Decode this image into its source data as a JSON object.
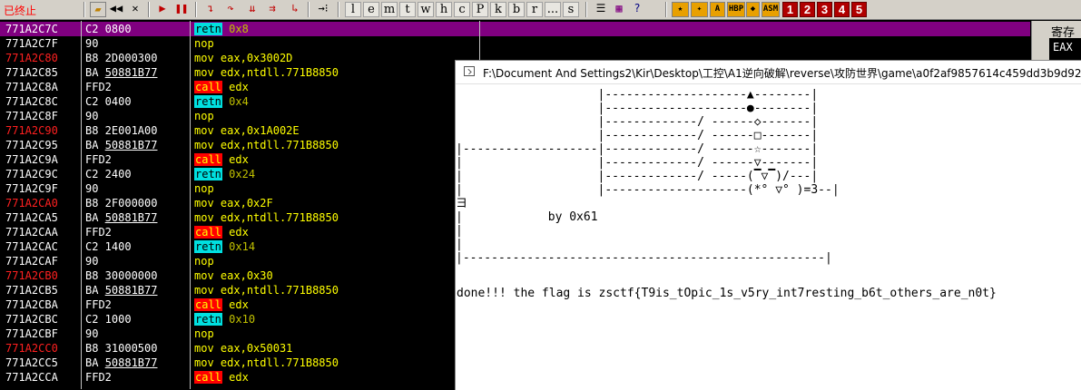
{
  "toolbar": {
    "status": "已终止",
    "letters": [
      "l",
      "e",
      "m",
      "t",
      "w",
      "h",
      "c",
      "P",
      "k",
      "b",
      "r",
      "...",
      "s"
    ],
    "numbers": [
      "1",
      "2",
      "3",
      "4",
      "5"
    ],
    "misc": [
      "HBP",
      "ASM"
    ]
  },
  "disasm": {
    "rows": [
      {
        "addr": "771A2C7C",
        "addr_red": false,
        "hex": "C2 0800",
        "mn": "retn",
        "kind": "ret",
        "ops": "0x8",
        "sel": true
      },
      {
        "addr": "771A2C7F",
        "addr_red": false,
        "hex": "90",
        "mn": "nop",
        "kind": "plain",
        "ops": ""
      },
      {
        "addr": "771A2C80",
        "addr_red": true,
        "hex": "B8 2D000300",
        "mn": "mov",
        "kind": "plain",
        "ops": "eax,0x3002D"
      },
      {
        "addr": "771A2C85",
        "addr_red": false,
        "hex": "BA 50881B77",
        "mn": "mov",
        "kind": "plain",
        "ops": "edx,ntdll.771B8850",
        "under": true
      },
      {
        "addr": "771A2C8A",
        "addr_red": false,
        "hex": "FFD2",
        "mn": "call",
        "kind": "call",
        "ops": "edx"
      },
      {
        "addr": "771A2C8C",
        "addr_red": false,
        "hex": "C2 0400",
        "mn": "retn",
        "kind": "ret",
        "ops": "0x4"
      },
      {
        "addr": "771A2C8F",
        "addr_red": false,
        "hex": "90",
        "mn": "nop",
        "kind": "plain",
        "ops": ""
      },
      {
        "addr": "771A2C90",
        "addr_red": true,
        "hex": "B8 2E001A00",
        "mn": "mov",
        "kind": "plain",
        "ops": "eax,0x1A002E"
      },
      {
        "addr": "771A2C95",
        "addr_red": false,
        "hex": "BA 50881B77",
        "mn": "mov",
        "kind": "plain",
        "ops": "edx,ntdll.771B8850",
        "under": true
      },
      {
        "addr": "771A2C9A",
        "addr_red": false,
        "hex": "FFD2",
        "mn": "call",
        "kind": "call",
        "ops": "edx"
      },
      {
        "addr": "771A2C9C",
        "addr_red": false,
        "hex": "C2 2400",
        "mn": "retn",
        "kind": "ret",
        "ops": "0x24"
      },
      {
        "addr": "771A2C9F",
        "addr_red": false,
        "hex": "90",
        "mn": "nop",
        "kind": "plain",
        "ops": ""
      },
      {
        "addr": "771A2CA0",
        "addr_red": true,
        "hex": "B8 2F000000",
        "mn": "mov",
        "kind": "plain",
        "ops": "eax,0x2F"
      },
      {
        "addr": "771A2CA5",
        "addr_red": false,
        "hex": "BA 50881B77",
        "mn": "mov",
        "kind": "plain",
        "ops": "edx,ntdll.771B8850",
        "under": true
      },
      {
        "addr": "771A2CAA",
        "addr_red": false,
        "hex": "FFD2",
        "mn": "call",
        "kind": "call",
        "ops": "edx"
      },
      {
        "addr": "771A2CAC",
        "addr_red": false,
        "hex": "C2 1400",
        "mn": "retn",
        "kind": "ret",
        "ops": "0x14"
      },
      {
        "addr": "771A2CAF",
        "addr_red": false,
        "hex": "90",
        "mn": "nop",
        "kind": "plain",
        "ops": ""
      },
      {
        "addr": "771A2CB0",
        "addr_red": true,
        "hex": "B8 30000000",
        "mn": "mov",
        "kind": "plain",
        "ops": "eax,0x30"
      },
      {
        "addr": "771A2CB5",
        "addr_red": false,
        "hex": "BA 50881B77",
        "mn": "mov",
        "kind": "plain",
        "ops": "edx,ntdll.771B8850",
        "under": true
      },
      {
        "addr": "771A2CBA",
        "addr_red": false,
        "hex": "FFD2",
        "mn": "call",
        "kind": "call",
        "ops": "edx"
      },
      {
        "addr": "771A2CBC",
        "addr_red": false,
        "hex": "C2 1000",
        "mn": "retn",
        "kind": "ret",
        "ops": "0x10"
      },
      {
        "addr": "771A2CBF",
        "addr_red": false,
        "hex": "90",
        "mn": "nop",
        "kind": "plain",
        "ops": ""
      },
      {
        "addr": "771A2CC0",
        "addr_red": true,
        "hex": "B8 31000500",
        "mn": "mov",
        "kind": "plain",
        "ops": "eax,0x50031"
      },
      {
        "addr": "771A2CC5",
        "addr_red": false,
        "hex": "BA 50881B77",
        "mn": "mov",
        "kind": "plain",
        "ops": "edx,ntdll.771B8850",
        "under": true
      },
      {
        "addr": "771A2CCA",
        "addr_red": false,
        "hex": "FFD2",
        "mn": "call",
        "kind": "call",
        "ops": "edx"
      }
    ]
  },
  "registers": {
    "title": "寄存",
    "first": "EAX"
  },
  "console": {
    "title": "F:\\Document And Settings2\\Kir\\Desktop\\工控\\A1逆向破解\\reverse\\攻防世界\\game\\a0f2af9857614c459dd3b9d9232",
    "art": [
      "                    |--------------------▲--------|",
      "                    |--------------------●--------|",
      "                    |-------------/ ------◇-------|",
      "                    |-------------/ ------□-------|",
      "|-------------------|-------------/ ------☆-------|",
      "|                   |-------------/ ------▽-------|",
      "|                   |-------------/ -----(▔▽▔)/---|",
      "|                   |--------------------(*° ▽° )=3--|",
      "ヨ",
      "|            by 0x61",
      "|",
      "|",
      "|---------------------------------------------------|"
    ],
    "flag": "done!!! the flag is zsctf{T9is_tOpic_1s_v5ry_int7resting_b6t_others_are_n0t}"
  }
}
